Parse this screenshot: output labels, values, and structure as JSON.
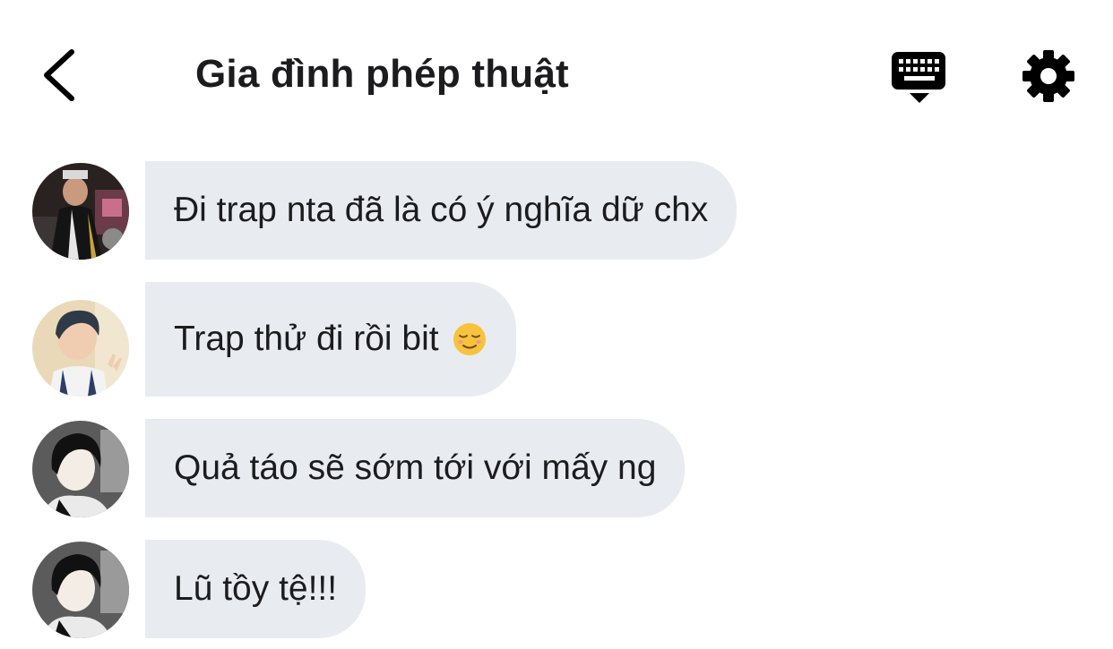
{
  "header": {
    "title": "Gia đình phép thuật",
    "back_icon": "chevron-left-icon",
    "keyboard_icon": "keyboard-icon",
    "settings_icon": "gear-icon"
  },
  "messages": [
    {
      "text": "Đi trap nta đã là có ý nghĩa dữ chx",
      "avatar": "avatar-1"
    },
    {
      "text": "Trap thử đi rồi bit",
      "emoji": "relieved-face-emoji",
      "avatar": "avatar-2"
    },
    {
      "text": "Quả táo sẽ sớm tới với mấy ng",
      "avatar": "avatar-3"
    },
    {
      "text": "Lũ tồy tệ!!!",
      "avatar": "avatar-3"
    }
  ],
  "colors": {
    "bubble": "#e8ecf1",
    "text": "#1c1c1e",
    "icon": "#000000"
  }
}
